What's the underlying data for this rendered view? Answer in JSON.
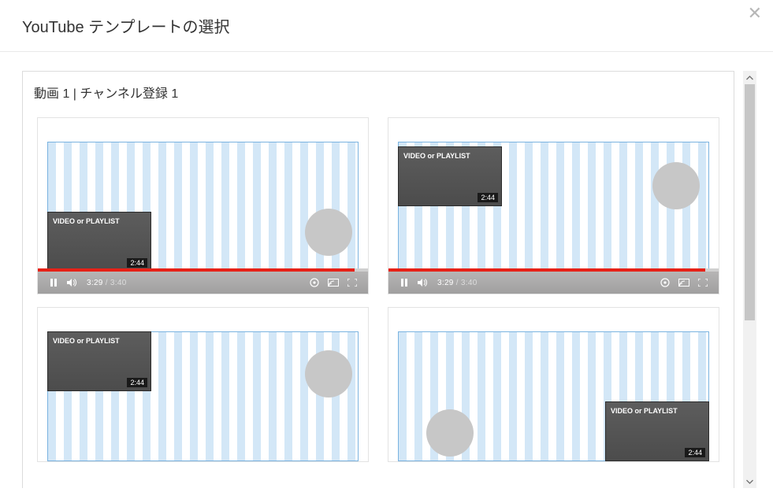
{
  "dialog": {
    "title": "YouTube テンプレートの選択",
    "section_title": "動画 1 | チャンネル登録 1"
  },
  "thumb": {
    "label": "VIDEO or PLAYLIST",
    "time": "2:44"
  },
  "player": {
    "elapsed": "3:29",
    "separator": " / ",
    "duration": "3:40",
    "progress_pct": 96
  },
  "templates": [
    {
      "has_controls": true,
      "thumb_pos": "bottom-left",
      "avatar_pos": "right-mid"
    },
    {
      "has_controls": true,
      "thumb_pos": "top-left",
      "avatar_pos": "right-high"
    },
    {
      "has_controls": false,
      "thumb_pos": "top-left",
      "avatar_pos": "right-mid"
    },
    {
      "has_controls": false,
      "thumb_pos": "bottom-right",
      "avatar_pos": "left-low"
    }
  ]
}
